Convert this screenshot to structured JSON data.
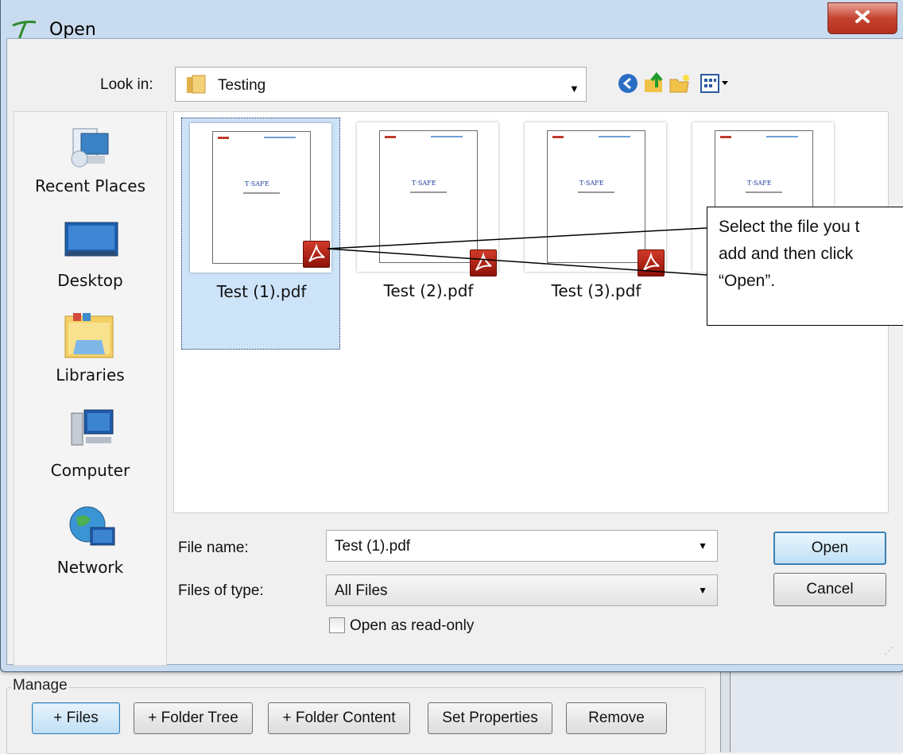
{
  "dialog": {
    "title": "Open",
    "look_in": {
      "label": "Look in:",
      "value": "Testing"
    },
    "places": [
      {
        "label": "Recent Places",
        "icon": "recent-places-icon"
      },
      {
        "label": "Desktop",
        "icon": "desktop-icon"
      },
      {
        "label": "Libraries",
        "icon": "libraries-icon"
      },
      {
        "label": "Computer",
        "icon": "computer-icon"
      },
      {
        "label": "Network",
        "icon": "network-icon"
      }
    ],
    "files": [
      {
        "name": "Test (1).pdf",
        "selected": true
      },
      {
        "name": "Test (2).pdf",
        "selected": false
      },
      {
        "name": "Test (3).pdf",
        "selected": false
      },
      {
        "name": "",
        "selected": false
      }
    ],
    "file_name": {
      "label": "File name:",
      "value": "Test (1).pdf"
    },
    "file_type": {
      "label": "Files of type:",
      "value": "All Files"
    },
    "read_only": {
      "label": "Open as read-only",
      "checked": false
    },
    "open_label": "Open",
    "cancel_label": "Cancel"
  },
  "callout": {
    "lines": [
      "Select the file you t",
      "add and then click",
      "“Open”."
    ]
  },
  "manage": {
    "label": "Manage",
    "buttons": [
      "+ Files",
      "+ Folder Tree",
      "+ Folder Content",
      "Set Properties",
      "Remove"
    ]
  },
  "colors": {
    "titlebar": "#c9dbee",
    "close_button": "#c5432f",
    "selection": "#cde3f8",
    "pdf_badge": "#b52318"
  }
}
